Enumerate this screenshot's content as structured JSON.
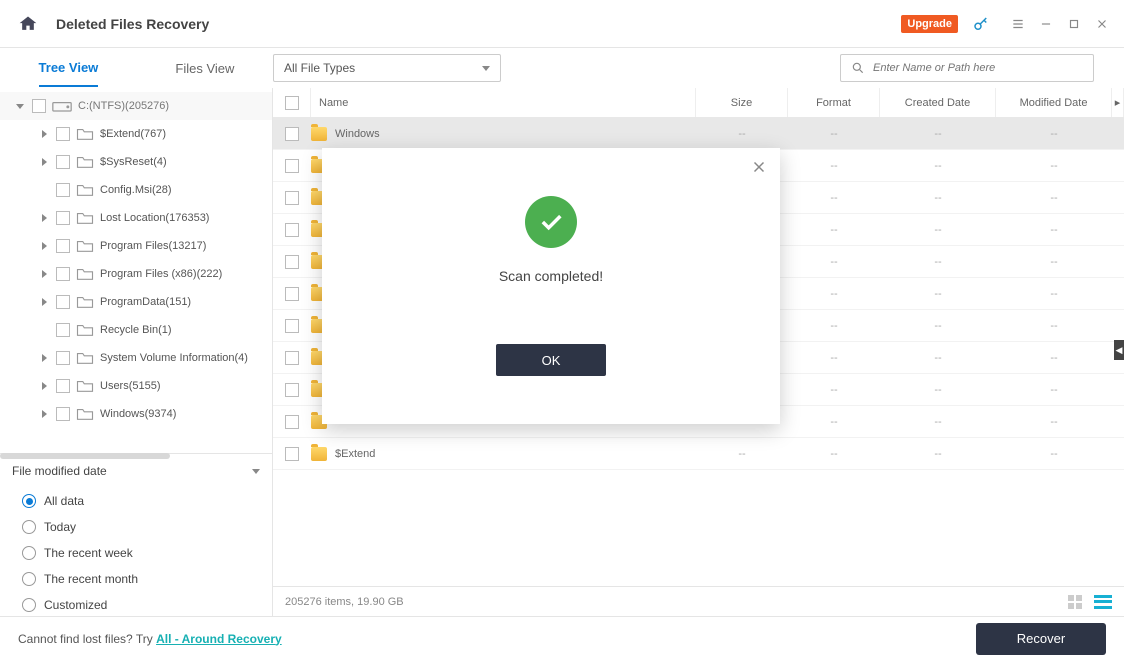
{
  "titlebar": {
    "title": "Deleted Files Recovery",
    "upgrade": "Upgrade"
  },
  "toolbar": {
    "tabs": {
      "tree": "Tree View",
      "files": "Files View"
    },
    "filter": "All File Types",
    "search_placeholder": "Enter Name or Path here"
  },
  "tree": {
    "root": "C:(NTFS)(205276)",
    "items": [
      "$Extend(767)",
      "$SysReset(4)",
      "Config.Msi(28)",
      "Lost Location(176353)",
      "Program Files(13217)",
      "Program Files (x86)(222)",
      "ProgramData(151)",
      "Recycle Bin(1)",
      "System Volume Information(4)",
      "Users(5155)",
      "Windows(9374)"
    ],
    "expandable": [
      true,
      true,
      false,
      true,
      true,
      true,
      true,
      false,
      true,
      true,
      true
    ]
  },
  "table": {
    "headers": {
      "name": "Name",
      "size": "Size",
      "format": "Format",
      "created": "Created Date",
      "modified": "Modified Date"
    },
    "rows": [
      {
        "name": "Windows",
        "hl": true,
        "placeholder": "--"
      },
      {
        "name": "",
        "placeholder": "--"
      },
      {
        "name": "",
        "placeholder": "--"
      },
      {
        "name": "",
        "placeholder": "--"
      },
      {
        "name": "",
        "placeholder": "--"
      },
      {
        "name": "",
        "placeholder": "--"
      },
      {
        "name": "",
        "placeholder": "--"
      },
      {
        "name": "",
        "placeholder": "--"
      },
      {
        "name": "",
        "placeholder": "--"
      },
      {
        "name": "",
        "placeholder": "--"
      },
      {
        "name": "$Extend",
        "placeholder": "--"
      }
    ],
    "status": "205276 items, 19.90 GB"
  },
  "filter_panel": {
    "title": "File modified date",
    "options": [
      "All data",
      "Today",
      "The recent week",
      "The recent month",
      "Customized"
    ],
    "selected": 0
  },
  "footer": {
    "hint_prefix": "Cannot find lost files? Try ",
    "hint_link": "All - Around Recovery",
    "recover": "Recover"
  },
  "modal": {
    "message": "Scan completed!",
    "ok": "OK"
  }
}
